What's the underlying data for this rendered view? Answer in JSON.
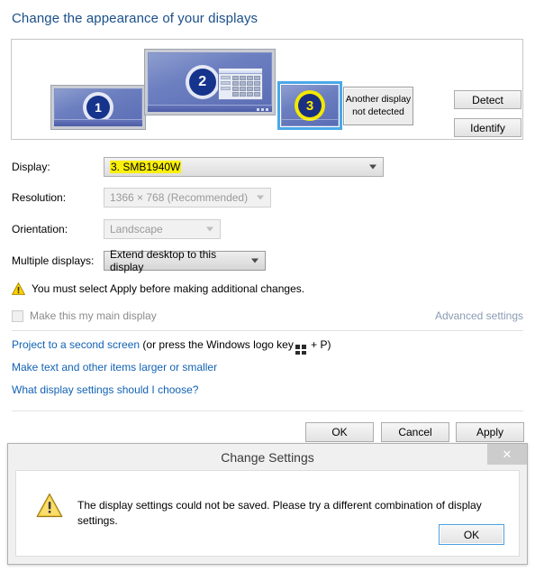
{
  "page": {
    "title": "Change the appearance of your displays"
  },
  "preview": {
    "monitors": [
      {
        "number": "1",
        "name": "monitor-1",
        "selected": false
      },
      {
        "number": "2",
        "name": "monitor-2",
        "selected": false
      },
      {
        "number": "3",
        "name": "monitor-3",
        "selected": true
      }
    ],
    "undetected_label": "Another display\nnot detected",
    "undetected_line1": "Another display",
    "undetected_line2": "not detected",
    "detect_button": "Detect",
    "identify_button": "Identify"
  },
  "form": {
    "display_label": "Display:",
    "display_value": "3. SMB1940W",
    "resolution_label": "Resolution:",
    "resolution_value": "1366 × 768 (Recommended)",
    "orientation_label": "Orientation:",
    "orientation_value": "Landscape",
    "multiple_displays_label": "Multiple displays:",
    "multiple_displays_value": "Extend desktop to this display"
  },
  "warning": {
    "text": "You must select Apply before making additional changes."
  },
  "main_display": {
    "checkbox_label": "Make this my main display",
    "checked": false,
    "advanced_settings_link": "Advanced settings"
  },
  "links": {
    "project_prefix": "Project to a second screen",
    "project_middle": " (or press the Windows logo key",
    "project_suffix": " + P)",
    "text_size": "Make text and other items larger or smaller",
    "which_settings": "What display settings should I choose?"
  },
  "footer": {
    "ok": "OK",
    "cancel": "Cancel",
    "apply": "Apply"
  },
  "dialog": {
    "title": "Change Settings",
    "close_glyph": "✕",
    "message": "The display settings could not be saved. Please try a different combination of display settings.",
    "ok": "OK"
  },
  "colors": {
    "heading": "#1a4f8a",
    "link": "#1262b3",
    "highlight": "#fbf00b",
    "selection_border": "#4aa8e8",
    "warning_yellow": "#f5c518"
  }
}
